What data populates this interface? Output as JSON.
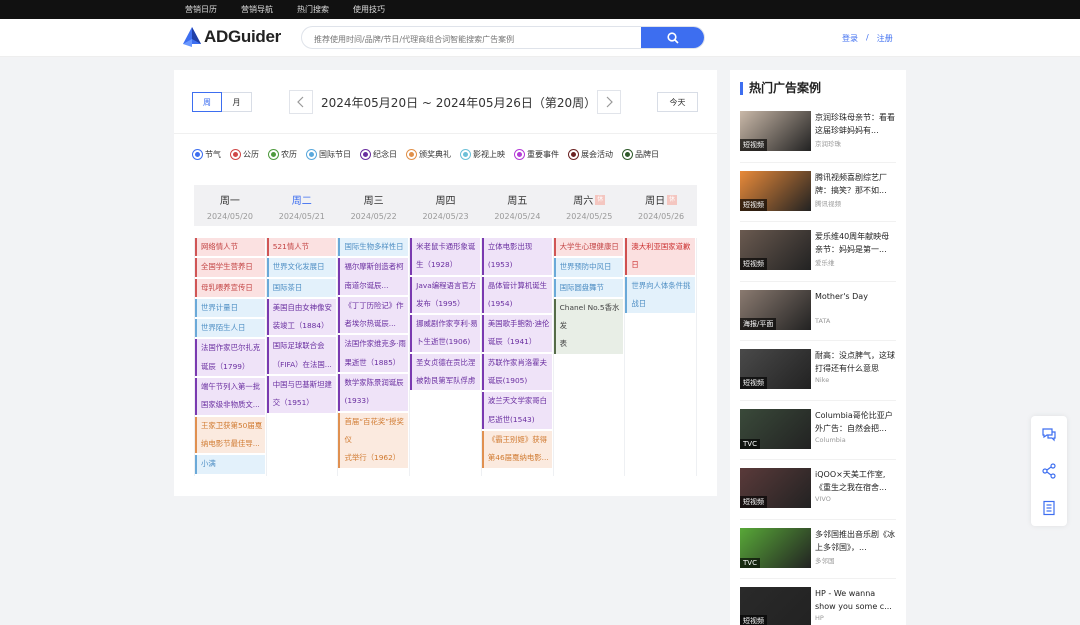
{
  "topnav": [
    "营销日历",
    "营销导航",
    "热门搜索",
    "使用技巧"
  ],
  "header": {
    "logo_text": "ADGuider",
    "search_placeholder": "推荐使用时间/品牌/节日/代理商组合词智能搜索广告案例",
    "login": "登录",
    "separator": "/",
    "register": "注册"
  },
  "calendar": {
    "view_week": "周",
    "view_month": "月",
    "range": "2024年05月20日 ~ 2024年05月26日（第20周）",
    "today": "今天",
    "legend": [
      {
        "label": "节气",
        "color": "#3d6ef0"
      },
      {
        "label": "公历",
        "color": "#d04848"
      },
      {
        "label": "农历",
        "color": "#4e9a3e"
      },
      {
        "label": "国际节日",
        "color": "#5aa8dc"
      },
      {
        "label": "纪念日",
        "color": "#6a2fa0"
      },
      {
        "label": "颁奖典礼",
        "color": "#e0904a"
      },
      {
        "label": "影视上映",
        "color": "#6cc0d8"
      },
      {
        "label": "重要事件",
        "color": "#b33ad6"
      },
      {
        "label": "展会活动",
        "color": "#6b2222"
      },
      {
        "label": "品牌日",
        "color": "#2f5a2a"
      }
    ],
    "days": [
      {
        "name": "周一",
        "date": "2024/05/20",
        "rest": "",
        "events": [
          {
            "t": "red",
            "lines": [
              "网络情人节"
            ]
          },
          {
            "t": "red",
            "lines": [
              "全国学生营养日"
            ]
          },
          {
            "t": "red",
            "lines": [
              "母乳喂养宣传日"
            ]
          },
          {
            "t": "blue",
            "lines": [
              "世界计量日"
            ]
          },
          {
            "t": "blue",
            "lines": [
              "世界陌生人日"
            ]
          },
          {
            "t": "purple",
            "lines": [
              "法国作家巴尔扎克",
              "诞辰（1799）"
            ]
          },
          {
            "t": "purple",
            "lines": [
              "端午节列入第一批",
              "国家级非物质文..."
            ]
          },
          {
            "t": "orange",
            "lines": [
              "王家卫获第50届戛",
              "纳电影节最佳导..."
            ]
          },
          {
            "t": "blue",
            "lines": [
              "小满"
            ]
          }
        ]
      },
      {
        "name": "周二",
        "date": "2024/05/21",
        "rest": "",
        "current": true,
        "events": [
          {
            "t": "red",
            "lines": [
              "521情人节"
            ]
          },
          {
            "t": "blue",
            "lines": [
              "世界文化发展日"
            ]
          },
          {
            "t": "blue",
            "lines": [
              "国际茶日"
            ]
          },
          {
            "t": "purple",
            "lines": [
              "美国自由女神像安",
              "装竣工（1884）"
            ]
          },
          {
            "t": "purple",
            "lines": [
              "国际足球联合会",
              "（FIFA）在法国..."
            ]
          },
          {
            "t": "purple",
            "lines": [
              "中国与巴基斯坦建",
              "交（1951）"
            ]
          }
        ]
      },
      {
        "name": "周三",
        "date": "2024/05/22",
        "rest": "",
        "events": [
          {
            "t": "blue",
            "lines": [
              "国际生物多样性日"
            ]
          },
          {
            "t": "purple",
            "lines": [
              "福尔摩斯创造者柯",
              "南道尔诞辰..."
            ]
          },
          {
            "t": "purple",
            "lines": [
              "《丁丁历险记》作",
              "者埃尔热诞辰..."
            ]
          },
          {
            "t": "purple",
            "lines": [
              "法国作家维克多·雨",
              "果逝世（1885）"
            ]
          },
          {
            "t": "purple",
            "lines": [
              "数学家陈景润诞辰",
              "(1933)"
            ]
          },
          {
            "t": "orange",
            "lines": [
              "首届“百花奖”授奖仪",
              "式举行（1962）"
            ]
          }
        ]
      },
      {
        "name": "周四",
        "date": "2024/05/23",
        "rest": "",
        "events": [
          {
            "t": "purple",
            "lines": [
              "米老鼠卡通形象诞",
              "生（1928）"
            ]
          },
          {
            "t": "purple",
            "lines": [
              "Java编程语言官方",
              "发布（1995）"
            ]
          },
          {
            "t": "purple",
            "lines": [
              "挪威剧作家亨利·易",
              "卜生逝世(1906)"
            ]
          },
          {
            "t": "purple",
            "lines": [
              "圣女贞德在贡比涅",
              "被勃艮第军队俘虏"
            ]
          }
        ]
      },
      {
        "name": "周五",
        "date": "2024/05/24",
        "rest": "",
        "events": [
          {
            "t": "purple",
            "lines": [
              "立体电影出现(1953)"
            ]
          },
          {
            "t": "purple",
            "lines": [
              "晶体管计算机诞生",
              "(1954)"
            ]
          },
          {
            "t": "purple",
            "lines": [
              "美国歌手鲍勃·迪伦",
              "诞辰（1941）"
            ]
          },
          {
            "t": "purple",
            "lines": [
              "苏联作家肖洛霍夫",
              "诞辰(1905)"
            ]
          },
          {
            "t": "purple",
            "lines": [
              "波兰天文学家哥白",
              "尼逝世(1543)"
            ]
          },
          {
            "t": "orange",
            "lines": [
              "《霸王别姬》获得",
              "第46届戛纳电影..."
            ]
          }
        ]
      },
      {
        "name": "周六",
        "date": "2024/05/25",
        "rest": "休",
        "events": [
          {
            "t": "red",
            "lines": [
              "大学生心理健康日"
            ]
          },
          {
            "t": "blue",
            "lines": [
              "世界预防中风日"
            ]
          },
          {
            "t": "blue",
            "lines": [
              "国际圆盘舞节"
            ]
          },
          {
            "t": "green",
            "lines": [
              "Chanel No.5香水发",
              "表"
            ]
          }
        ]
      },
      {
        "name": "周日",
        "date": "2024/05/26",
        "rest": "休",
        "events": [
          {
            "t": "pink",
            "lines": [
              "澳大利亚国家道歉",
              "日"
            ]
          },
          {
            "t": "blue",
            "lines": [
              "世界向人体条件挑",
              "战日"
            ]
          }
        ]
      }
    ]
  },
  "sidebar": {
    "title": "热门广告案例",
    "items": [
      {
        "title": "京润珍珠母亲节：看看这届珍蚌妈妈有...",
        "source": "京润珍珠",
        "tag": "短视频",
        "bg": "#c9b8a8"
      },
      {
        "title": "腾讯视频喜剧综艺厂牌：搞笑？那不如...",
        "source": "腾讯视频",
        "tag": "短视频",
        "bg": "#e88a3a"
      },
      {
        "title": "爱乐维40周年献映母亲节：妈妈是第一...",
        "source": "爱乐维",
        "tag": "短视频",
        "bg": "#6a5a50"
      },
      {
        "title": "Mother's Day",
        "source": "TATA",
        "tag": "海报/平面",
        "bg": "#8a7a70"
      },
      {
        "title": "耐高：没点脾气，这球打得还有什么意思",
        "source": "Nike",
        "tag": "短视频",
        "bg": "#4a4a4a"
      },
      {
        "title": "Columbia哥伦比亚户外广告：自然会把...",
        "source": "Columbia",
        "tag": "TVC",
        "bg": "#3a4a3a"
      },
      {
        "title": "iQOO×天美工作室,《重生之我在宿舍...",
        "source": "VIVO",
        "tag": "短视频",
        "bg": "#5a3a3a"
      },
      {
        "title": "多邻国推出音乐剧《冰上多邻国》，...",
        "source": "多邻国",
        "tag": "TVC",
        "bg": "#58a838"
      },
      {
        "title": "HP - We wanna show you some c...",
        "source": "HP",
        "tag": "短视频",
        "bg": "#2a2a2a"
      }
    ]
  }
}
